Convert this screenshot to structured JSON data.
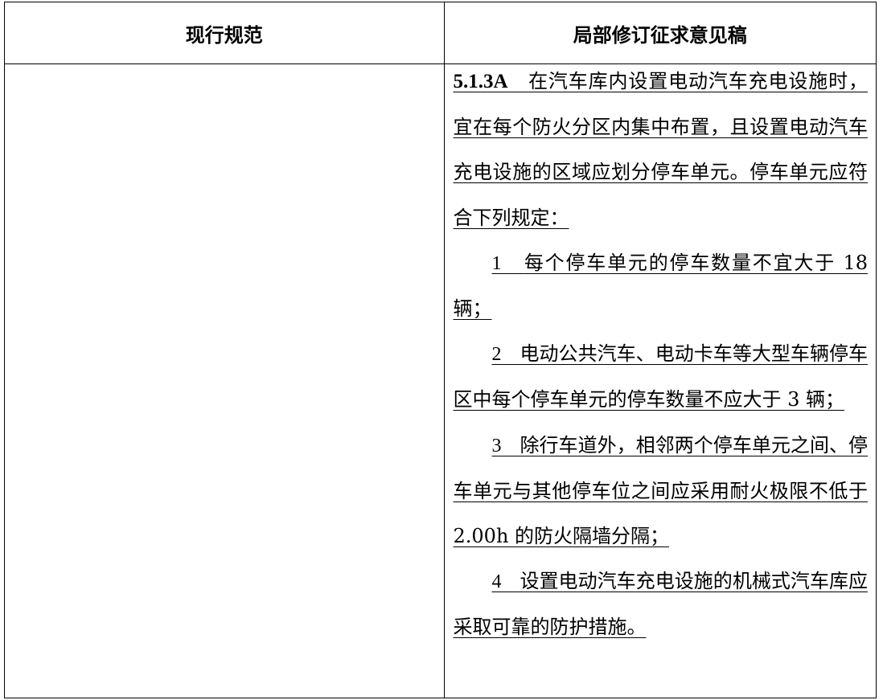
{
  "table": {
    "header_left": "现行规范",
    "header_right": "局部修订征求意见稿"
  },
  "clause": {
    "number": "5.1.3A",
    "text": "在汽车库内设置电动汽车充电设施时，宜在每个防火分区内集中布置，且设置电动汽车充电设施的区域应划分停车单元。停车单元应符合下列规定："
  },
  "items": [
    {
      "num": "1",
      "text": "每个停车单元的停车数量不宜大于 18 辆；"
    },
    {
      "num": "2",
      "text": "电动公共汽车、电动卡车等大型车辆停车区中每个停车单元的停车数量不应大于 3 辆；"
    },
    {
      "num": "3",
      "text": "除行车道外，相邻两个停车单元之间、停车单元与其他停车位之间应采用耐火极限不低于 2.00h 的防火隔墙分隔；"
    },
    {
      "num": "4",
      "text": "设置电动汽车充电设施的机械式汽车库应采取可靠的防护措施。"
    }
  ]
}
